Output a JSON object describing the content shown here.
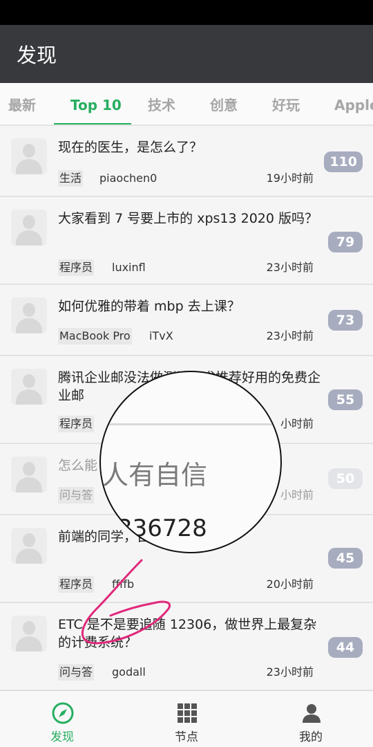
{
  "app": {
    "title": "发现"
  },
  "tabs": [
    {
      "label": "最新",
      "active": false
    },
    {
      "label": "Top 10",
      "active": true
    },
    {
      "label": "技术",
      "active": false
    },
    {
      "label": "创意",
      "active": false
    },
    {
      "label": "好玩",
      "active": false
    },
    {
      "label": "Apple",
      "active": false
    }
  ],
  "topics": [
    {
      "title": "现在的医生，是怎么了？",
      "tag": "生活",
      "author": "piaochen0",
      "time": "19小时前",
      "replies": "110"
    },
    {
      "title": "大家看到 7 号要上市的 xps13 2020 版吗？",
      "tag": "程序员",
      "author": "luxinfl",
      "time": "23小时前",
      "replies": "79"
    },
    {
      "title": "如何优雅的带着 mbp 去上课？",
      "tag": "MacBook Pro",
      "author": "iTvX",
      "time": "23小时前",
      "replies": "73"
    },
    {
      "title": "腾讯企业邮没法做测试，求推荐好用的免费企业邮",
      "tag": "程序员",
      "author": "",
      "time": "小时前",
      "replies": "55"
    },
    {
      "title": "怎么能",
      "tag": "问与答",
      "author": "",
      "time": "小时前",
      "replies": "50"
    },
    {
      "title": "前端的同学，自动化测试的？",
      "tag": "程序员",
      "author": "ffffb",
      "time": "20小时前",
      "replies": "45"
    },
    {
      "title": "ETC 是不是要追随 12306，做世界上最复杂的计费系统？",
      "tag": "问与答",
      "author": "godall",
      "time": "23小时前",
      "replies": "44"
    }
  ],
  "magnifier": {
    "text": "人有自信",
    "number": "336728"
  },
  "bottom_nav": [
    {
      "label": "发现",
      "icon": "compass-icon",
      "active": true
    },
    {
      "label": "节点",
      "icon": "grid-icon",
      "active": false
    },
    {
      "label": "我的",
      "icon": "person-icon",
      "active": false
    }
  ],
  "colors": {
    "accent": "#27ae60",
    "appbar": "#37393d",
    "badge": "#a7acbf",
    "scribble": "#e0287a"
  }
}
